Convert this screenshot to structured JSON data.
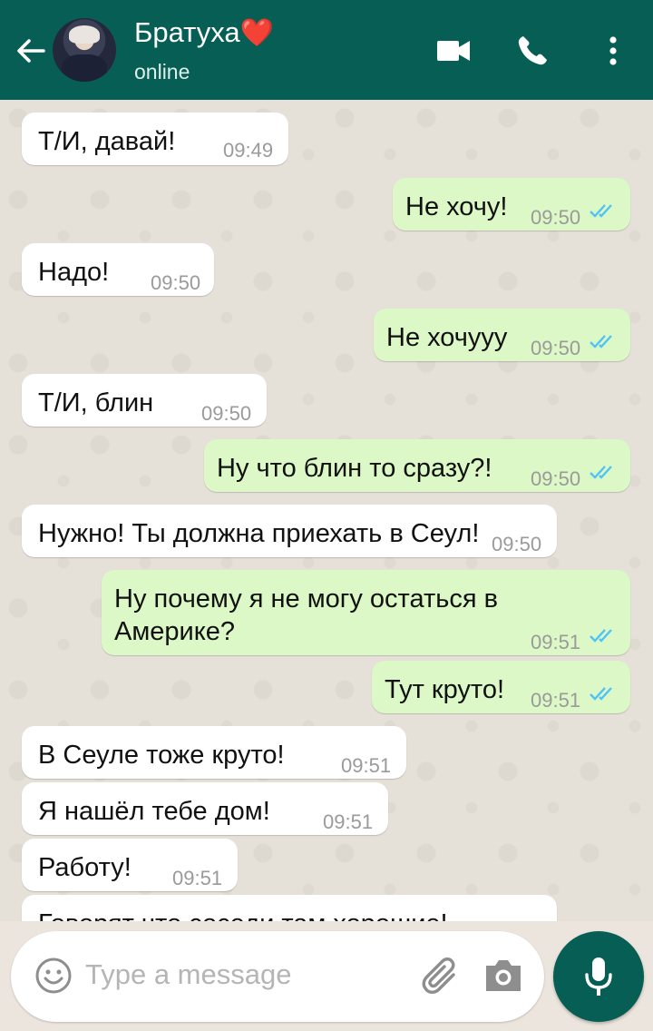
{
  "header": {
    "contact_name": "Братуха",
    "heart": "❤️",
    "status": "online",
    "back_icon": "arrow-left-icon",
    "video_icon": "video-camera-icon",
    "call_icon": "phone-icon",
    "menu_icon": "more-vertical-icon"
  },
  "messages": [
    {
      "dir": "in",
      "text": "Т/И, давай!",
      "time": "09:49"
    },
    {
      "dir": "out",
      "text": "Не хочу!",
      "time": "09:50"
    },
    {
      "dir": "in",
      "text": "Надо!",
      "time": "09:50"
    },
    {
      "dir": "out",
      "text": "Не хочууу",
      "time": "09:50"
    },
    {
      "dir": "in",
      "text": "Т/И, блин",
      "time": "09:50"
    },
    {
      "dir": "out",
      "text": "Ну что блин то сразу?!",
      "time": "09:50"
    },
    {
      "dir": "in",
      "text": "Нужно! Ты должна приехать в Сеул!",
      "time": "09:50"
    },
    {
      "dir": "out",
      "text": "Ну почему я не могу остаться в Америке?",
      "time": "09:51"
    },
    {
      "dir": "out",
      "text": "Тут круто!",
      "time": "09:51"
    },
    {
      "dir": "in",
      "text": "В Сеуле тоже круто!",
      "time": "09:51"
    },
    {
      "dir": "in",
      "text": "Я нашёл тебе дом!",
      "time": "09:51"
    },
    {
      "dir": "in",
      "text": "Работу!",
      "time": "09:51"
    },
    {
      "dir": "in",
      "text": "Говорят что соседи там хорошие!",
      "time": ""
    }
  ],
  "input": {
    "placeholder": "Type a message",
    "emoji_icon": "emoji-icon",
    "attach_icon": "paperclip-icon",
    "camera_icon": "camera-icon",
    "mic_icon": "microphone-icon"
  },
  "colors": {
    "header": "#075e54",
    "outgoing_bubble": "#dcf8c6",
    "incoming_bubble": "#ffffff",
    "read_ticks": "#4fc3f7"
  }
}
